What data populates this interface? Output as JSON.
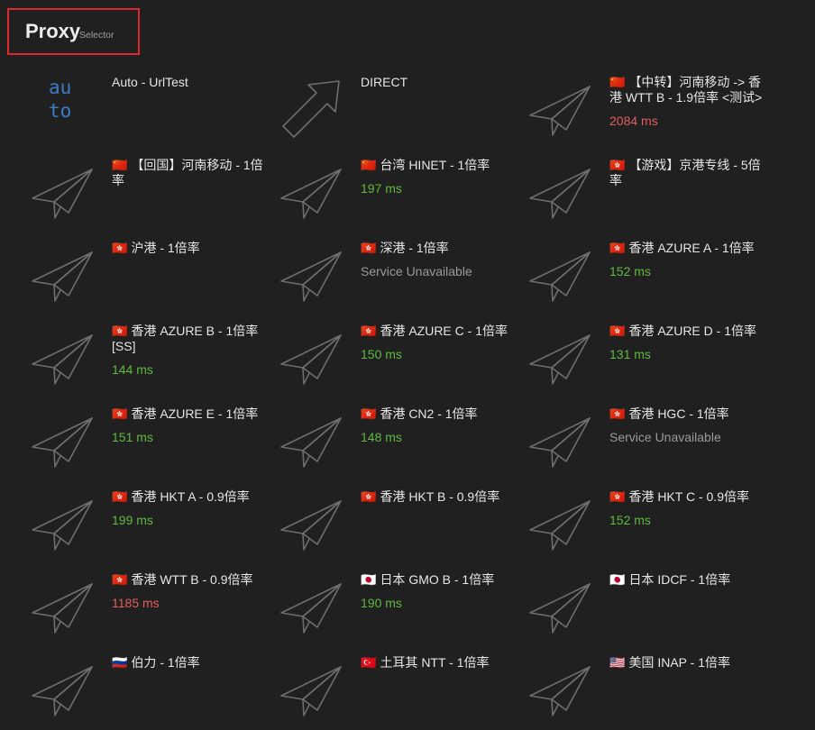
{
  "header": {
    "title": "Proxy",
    "type": "Selector"
  },
  "colors": {
    "delay_good": "#5fba3f",
    "delay_bad": "#e35d5d",
    "unavailable": "#9a9a9a",
    "auto_icon": "#3d7bc7",
    "header_border": "#e0272b"
  },
  "proxies": [
    {
      "icon": "auto",
      "auto_label": "au to",
      "flag": "",
      "name": "Auto - UrlTest",
      "delay": "",
      "status": ""
    },
    {
      "icon": "arrow-up-right-icon",
      "flag": "",
      "name": "DIRECT",
      "delay": "",
      "status": ""
    },
    {
      "icon": "paper-plane-icon",
      "flag": "🇨🇳",
      "name": "【中转】河南移动 -> 香港 WTT B - 1.9倍率 <测试>",
      "delay": "2084 ms",
      "status": "bad"
    },
    {
      "icon": "paper-plane-icon",
      "flag": "🇨🇳",
      "name": "【回国】河南移动 - 1倍率",
      "delay": "",
      "status": ""
    },
    {
      "icon": "paper-plane-icon",
      "flag": "🇨🇳",
      "name": "台湾 HINET - 1倍率",
      "delay": "197 ms",
      "status": "ok"
    },
    {
      "icon": "paper-plane-icon",
      "flag": "🇭🇰",
      "name": "【游戏】京港专线 - 5倍率",
      "delay": "",
      "status": ""
    },
    {
      "icon": "paper-plane-icon",
      "flag": "🇭🇰",
      "name": "沪港 - 1倍率",
      "delay": "",
      "status": ""
    },
    {
      "icon": "paper-plane-icon",
      "flag": "🇭🇰",
      "name": "深港 - 1倍率",
      "delay": "Service Unavailable",
      "status": "na"
    },
    {
      "icon": "paper-plane-icon",
      "flag": "🇭🇰",
      "name": "香港 AZURE A - 1倍率",
      "delay": "152 ms",
      "status": "ok"
    },
    {
      "icon": "paper-plane-icon",
      "flag": "🇭🇰",
      "name": "香港 AZURE B - 1倍率 [SS]",
      "delay": "144 ms",
      "status": "ok"
    },
    {
      "icon": "paper-plane-icon",
      "flag": "🇭🇰",
      "name": "香港 AZURE C - 1倍率",
      "delay": "150 ms",
      "status": "ok"
    },
    {
      "icon": "paper-plane-icon",
      "flag": "🇭🇰",
      "name": "香港 AZURE D - 1倍率",
      "delay": "131 ms",
      "status": "ok"
    },
    {
      "icon": "paper-plane-icon",
      "flag": "🇭🇰",
      "name": "香港 AZURE E - 1倍率",
      "delay": "151 ms",
      "status": "ok"
    },
    {
      "icon": "paper-plane-icon",
      "flag": "🇭🇰",
      "name": "香港 CN2 - 1倍率",
      "delay": "148 ms",
      "status": "ok"
    },
    {
      "icon": "paper-plane-icon",
      "flag": "🇭🇰",
      "name": "香港 HGC - 1倍率",
      "delay": "Service Unavailable",
      "status": "na"
    },
    {
      "icon": "paper-plane-icon",
      "flag": "🇭🇰",
      "name": "香港 HKT A - 0.9倍率",
      "delay": "199 ms",
      "status": "ok"
    },
    {
      "icon": "paper-plane-icon",
      "flag": "🇭🇰",
      "name": "香港 HKT B - 0.9倍率",
      "delay": "",
      "status": ""
    },
    {
      "icon": "paper-plane-icon",
      "flag": "🇭🇰",
      "name": "香港 HKT C - 0.9倍率",
      "delay": "152 ms",
      "status": "ok"
    },
    {
      "icon": "paper-plane-icon",
      "flag": "🇭🇰",
      "name": "香港 WTT B - 0.9倍率",
      "delay": "1185 ms",
      "status": "bad"
    },
    {
      "icon": "paper-plane-icon",
      "flag": "🇯🇵",
      "name": "日本 GMO B - 1倍率",
      "delay": "190 ms",
      "status": "ok"
    },
    {
      "icon": "paper-plane-icon",
      "flag": "🇯🇵",
      "name": "日本 IDCF - 1倍率",
      "delay": "",
      "status": ""
    },
    {
      "icon": "paper-plane-icon",
      "flag": "🇷🇺",
      "name": "伯力 - 1倍率",
      "delay": "",
      "status": ""
    },
    {
      "icon": "paper-plane-icon",
      "flag": "🇹🇷",
      "name": "土耳其 NTT - 1倍率",
      "delay": "",
      "status": ""
    },
    {
      "icon": "paper-plane-icon",
      "flag": "🇺🇸",
      "name": "美国 INAP - 1倍率",
      "delay": "",
      "status": ""
    }
  ]
}
